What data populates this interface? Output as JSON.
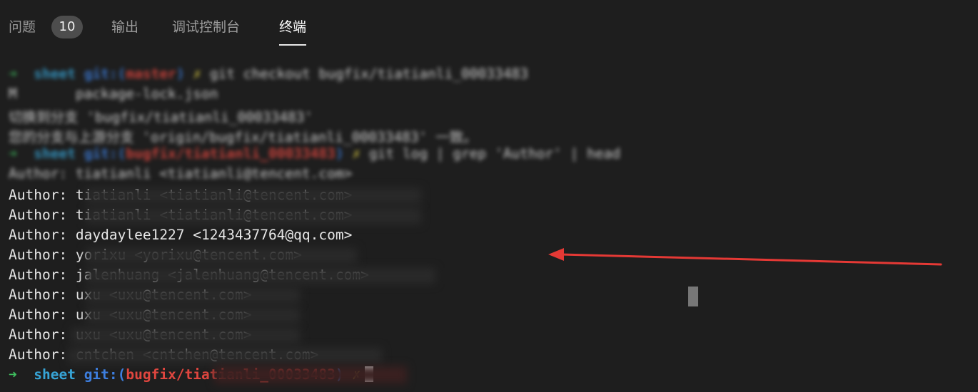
{
  "tabs": [
    {
      "label": "问题",
      "badge": "10",
      "active": false
    },
    {
      "label": "输出",
      "active": false
    },
    {
      "label": "调试控制台",
      "active": false
    },
    {
      "label": "终端",
      "active": true
    }
  ],
  "terminal": {
    "history": [
      {
        "arrow": "➜",
        "dir": "sheet",
        "git": "git:(",
        "branch": "master",
        "close": ")",
        "mark": "✗",
        "cmd": "git checkout bugfix/tiatianli_00033483"
      },
      {
        "text": "M       package-lock.json"
      },
      {
        "text": "切换到分支 'bugfix/tiatianli_00033483'"
      },
      {
        "text": "您的分支与上游分支 'origin/bugfix/tiatianli_00033483' 一致。"
      },
      {
        "arrow": "➜",
        "dir": "sheet",
        "git": "git:(",
        "branch": "bugfix/tiatianli_00033483",
        "close": ")",
        "mark": "✗",
        "cmd": "git log | grep 'Author' | head"
      },
      {
        "text": "Author: tiatianli <tiatianli@tencent.com>"
      }
    ],
    "authors": [
      "Author: tiatianli <tiatianli@tencent.com>",
      "Author: tiatianli <tiatianli@tencent.com>",
      "Author: daydaylee1227 <1243437764@qq.com>",
      "Author: yorixu <yorixu@tencent.com>",
      "Author: jalenhuang <jalenhuang@tencent.com>",
      "Author: uxu <uxu@tencent.com>",
      "Author: uxu <uxu@tencent.com>",
      "Author: uxu <uxu@tencent.com>",
      "Author: cntchen <cntchen@tencent.com>"
    ],
    "prompt": {
      "arrow": "➜",
      "dir": "sheet",
      "git": "git:(",
      "branch": "bugfix/tiatianli_00033483",
      "close": ")",
      "mark": "✗"
    }
  },
  "annotation": {
    "arrow_color": "#e53935"
  }
}
